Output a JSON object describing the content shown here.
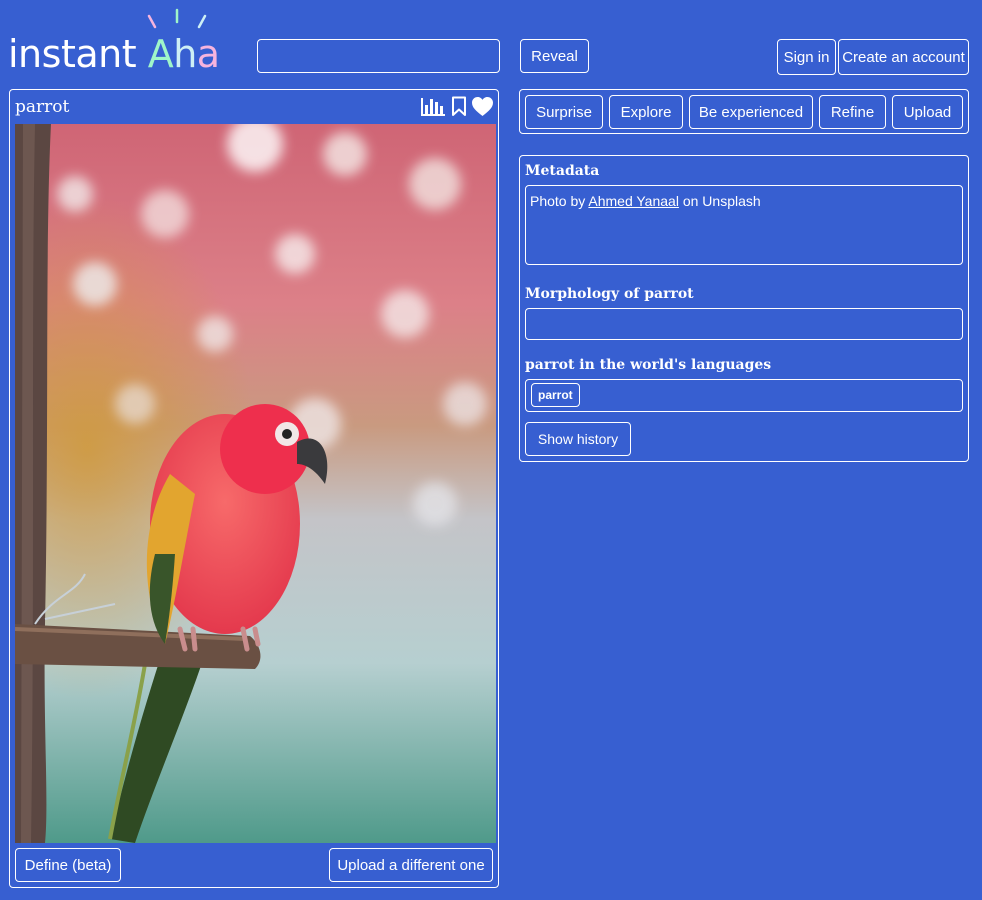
{
  "brand": {
    "logo_text_plain": "instant ",
    "logo_a": "A",
    "logo_h": "h",
    "logo_a2": "a",
    "colors": {
      "background": "#375fd1",
      "logo_a": "#9ff5c9",
      "logo_h": "#cdeff5",
      "logo_a2": "#f6b4de",
      "spark_pink": "#f6b4de",
      "spark_green": "#9ff5c9"
    }
  },
  "search": {
    "value": "",
    "placeholder": ""
  },
  "header": {
    "reveal_label": "Reveal",
    "sign_in_label": "Sign in",
    "create_account_label": "Create an account"
  },
  "card": {
    "title": "parrot",
    "icons": [
      "bar-chart-icon",
      "bookmark-icon",
      "heart-icon"
    ],
    "define_label": "Define (beta)",
    "upload_different_label": "Upload a different one"
  },
  "actions": {
    "surprise": "Surprise",
    "explore": "Explore",
    "be_experienced": "Be experienced",
    "refine": "Refine",
    "upload": "Upload"
  },
  "metadata": {
    "title": "Metadata",
    "credit_prefix": "Photo by ",
    "credit_author": "Ahmed Yanaal",
    "credit_suffix": " on Unsplash",
    "morphology_title": "Morphology of parrot",
    "languages_title": "parrot in the world's languages",
    "language_tags": [
      "parrot"
    ],
    "show_history_label": "Show history"
  }
}
